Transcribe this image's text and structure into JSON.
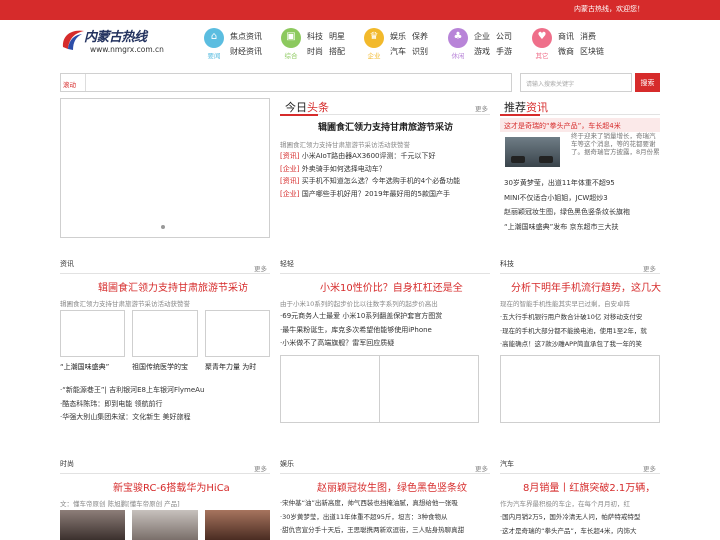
{
  "topbar": {
    "welcome": "内蒙古热线，欢迎您！"
  },
  "logo": {
    "name": "内蒙古热线",
    "url": "www.nmgrx.com.cn"
  },
  "nav": [
    {
      "caption": "要闻",
      "color": "#5bbde0",
      "icon": "⌂",
      "links": [
        "焦点资讯",
        "财经资讯"
      ]
    },
    {
      "caption": "综合",
      "color": "#8cc95e",
      "icon": "▣",
      "links": [
        "科技",
        "明星",
        "时尚",
        "搭配"
      ]
    },
    {
      "caption": "企业",
      "color": "#f2b92b",
      "icon": "♛",
      "links": [
        "娱乐",
        "保养",
        "汽车",
        "识别"
      ]
    },
    {
      "caption": "休闲",
      "color": "#b884d8",
      "icon": "♣",
      "links": [
        "企业",
        "公司",
        "游戏",
        "手游"
      ]
    },
    {
      "caption": "其它",
      "color": "#ef6f8a",
      "icon": "♥",
      "links": [
        "商讯",
        "消费",
        "微商",
        "区块链"
      ]
    }
  ],
  "search": {
    "tag": "滚动",
    "placeholder": "请输入搜索关键字",
    "button": "搜索"
  },
  "today": {
    "title_plain": "今日",
    "title_hl": "头条",
    "more": "更多",
    "headline": "辑圃食汇领力支持甘肃旅游节采访",
    "sub": "辑圃食汇领力支持甘肃旅游节采访活动获赞誉",
    "items": [
      {
        "tag": "[资讯]",
        "text": "小米AIoT路由器AX3600评测：千元以下好"
      },
      {
        "tag": "[企业]",
        "text": "外卖骑手如何选择电动车？"
      },
      {
        "tag": "[资讯]",
        "text": "买手机不知道怎么选？今年选购手机的4个必备功能"
      },
      {
        "tag": "[企业]",
        "text": "国产哪些手机好用？2019年最好用的5款国产手"
      }
    ]
  },
  "recommend": {
    "title_plain": "推荐",
    "title_hl": "资讯",
    "head": "这才是奇瑞的“拳头产品”，车长超4米",
    "text": "终于迎来了销量增长，奇瑞汽车等这个消息，等的花都要谢了。据奇瑞官方披露，8月份累",
    "items": [
      "30岁黄梦莹，出道11年体重不超95",
      "MINI不仅适合小姐姐，JCW超炒3",
      "赵丽颖冠妆生图，绿色黑色竖条纹长旗袍",
      "“上潮国味盛典”发布 京东超市三大扶"
    ]
  },
  "zixun": {
    "label": "资讯",
    "more": "更多",
    "headline": "辑圃食汇领力支持甘肃旅游节采访",
    "sub": "辑圃食汇领力支持甘肃旅游节采访活动获赞誉",
    "captions": [
      "“上潮国味盛典”",
      "祖国传统医学的宝",
      "聚青年力量 为时"
    ],
    "items": [
      "“新能源巷王”| 吉利银河E8上车银河FlymeAu",
      "酷态科陈玮：即到电能 领航前行",
      "华强大别山集团朱斌：文化新生 美好旅程"
    ]
  },
  "qinggan": {
    "label": "轻轻",
    "more": "更多",
    "headline": "小米10性价比？自身杠杠还是全",
    "sub": "由于小米10系列的起步价比以往数字系列的起步价高出",
    "items": [
      "69元商务人士最爱 小米10系列翻盖保护套官方图赏",
      "最牛果粉诞生，库克多次希望他能够使用iPhone",
      "小米做不了高端旗舰？雷军回应质疑"
    ]
  },
  "keji": {
    "label": "科技",
    "more": "更多",
    "headline": "分析下明年手机流行趋势，这几大",
    "sub": "现在的智能手机性能其实早已过剩，自安卓阵",
    "items": [
      "五大行手机银行用户数合计破10亿 对移动支付安",
      "现在的手机大部分都不能换电池，使用1至2年，就",
      "高能确点！这7款沙雕APP简直承包了我一年的笑"
    ]
  },
  "shishang": {
    "label": "时尚",
    "more": "更多",
    "headline": "新宝骏RC-6搭载华为HiCa",
    "sub": "文：懂车帝原创 陈旭鹏[懂车帝原创 产品]"
  },
  "yule": {
    "label": "娱乐",
    "more": "更多",
    "headline": "赵丽颖冠妆生图，绿色黑色竖条纹",
    "items": [
      "宋仲基“油”出新高度，帅气西装也挡掩油腻，真想给他一张吸",
      "30岁黄梦莹，出道11年体重不超95斤，坦言：3种食物从",
      "甜仇宫宣分手十天后，王思聪携两新欢逗街，三人贴身热聊真甜"
    ]
  },
  "qiche": {
    "label": "汽车",
    "more": "更多",
    "headline": "8月销量丨红旗突破2.1万辆，",
    "sub": "作为汽车界最积极的车企，在每个月月初，红",
    "items": [
      "国内月销2万5，国外冷清无人问，帕萨特戒特型",
      "这才是奇瑞的“拳头产品”，车长超4米，内饰大"
    ]
  }
}
